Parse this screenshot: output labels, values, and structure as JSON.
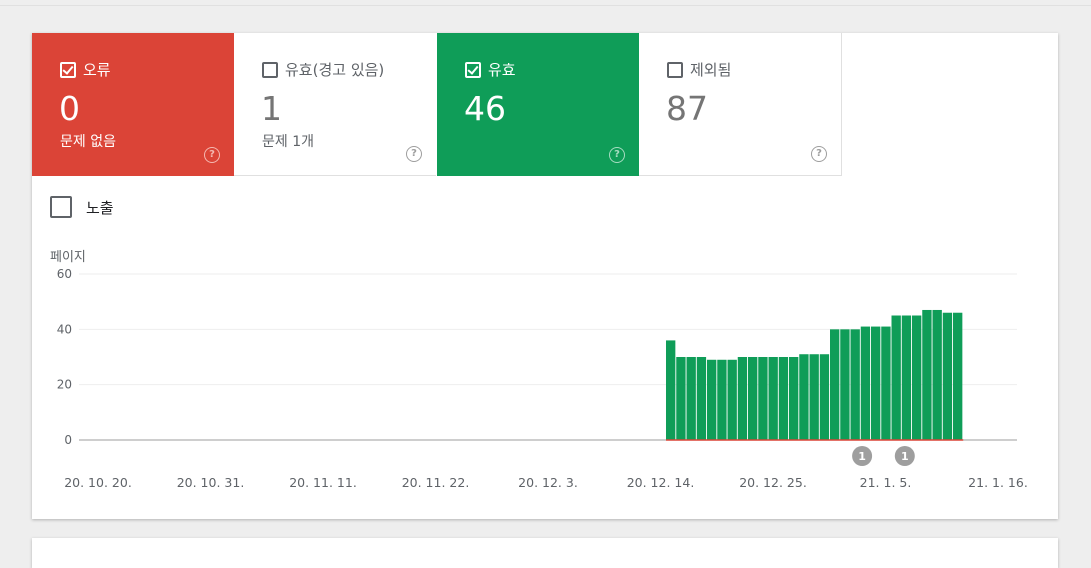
{
  "tiles": [
    {
      "label": "오류",
      "checked": true,
      "value": "0",
      "sub": "문제 없음",
      "style": "red"
    },
    {
      "label": "유효(경고 있음)",
      "checked": false,
      "value": "1",
      "sub": "문제 1개",
      "style": "plain"
    },
    {
      "label": "유효",
      "checked": true,
      "value": "46",
      "sub": "",
      "style": "green"
    },
    {
      "label": "제외됨",
      "checked": false,
      "value": "87",
      "sub": "",
      "style": "plain"
    }
  ],
  "help_glyph": "?",
  "impressions_label": "노출",
  "chart_data": {
    "type": "bar",
    "ylabel": "페이지",
    "ylim": [
      0,
      60
    ],
    "yticks": [
      "60",
      "40",
      "20",
      "0"
    ],
    "ytick_values": [
      60,
      40,
      20,
      0
    ],
    "xtick_labels": [
      "20. 10. 20.",
      "20. 10. 31.",
      "20. 11. 11.",
      "20. 11. 22.",
      "20. 12. 3.",
      "20. 12. 14.",
      "20. 12. 25.",
      "21. 1. 5.",
      "21. 1. 16."
    ],
    "start_date": "2020-10-20",
    "bar_start_date": "2020-12-14",
    "end_date": "2021-01-16",
    "series": [
      {
        "name": "유효",
        "color": "#0f9d58",
        "values": [
          36,
          30,
          30,
          30,
          29,
          29,
          29,
          30,
          30,
          30,
          30,
          30,
          30,
          31,
          31,
          31,
          40,
          40,
          40,
          41,
          41,
          41,
          45,
          45,
          45,
          47,
          47,
          46,
          46
        ]
      }
    ],
    "error_series": {
      "name": "오류",
      "color": "#db4437"
    },
    "annotations": [
      {
        "date": "2021-01-01",
        "label": "1"
      },
      {
        "date": "2021-01-05",
        "label": "1"
      }
    ],
    "colors": {
      "valid": "#0f9d58",
      "error": "#db4437",
      "grid": "#eeeeee",
      "axis": "#9e9e9e",
      "text": "#5f6368",
      "annotation": "#9e9e9e"
    }
  }
}
